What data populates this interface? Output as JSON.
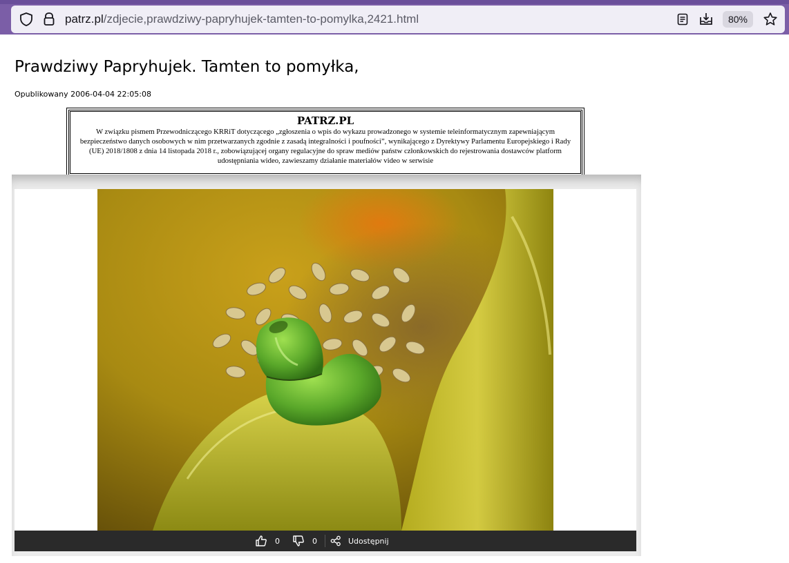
{
  "browser": {
    "url_domain": "patrz.pl",
    "url_path": "/zdjecie,prawdziwy-papryhujek-tamten-to-pomylka,2421.html",
    "zoom": "80%",
    "icons": [
      "shield-icon",
      "lock-icon",
      "reader-view-icon",
      "download-icon",
      "bookmark-star-icon"
    ]
  },
  "page": {
    "title": "Prawdziwy Papryhujek. Tamten to pomyłka,",
    "published": "Opublikowany 2006-04-04 22:05:08"
  },
  "notice": {
    "title": "PATRZ.PL",
    "body": "W związku pismem Przewodniczącego KRRiT dotyczącego „zgłoszenia o wpis do wykazu prowadzonego w systemie teleinformatycznym zapewniającym bezpieczeństwo danych osobowych w nim przetwarzanych zgodnie z zasadą integralności i poufności”, wynikającego z Dyrektywy Parlamentu Europejskiego i Rady (UE) 2018/1808 z dnia 14 listopada 2018 r., zobowiązującej organy regulacyjne do spraw mediów państw członkowskich do rejestrowania dostawców platform udostępniania wideo, zawieszamy działanie materiałów video w serwisie"
  },
  "actions": {
    "likes": "0",
    "dislikes": "0",
    "share_label": "Udostępnij"
  },
  "colors": {
    "browser_frame": "#7b5ea7",
    "url_bar": "#f0eef6",
    "action_bar": "#2a2a2a"
  }
}
